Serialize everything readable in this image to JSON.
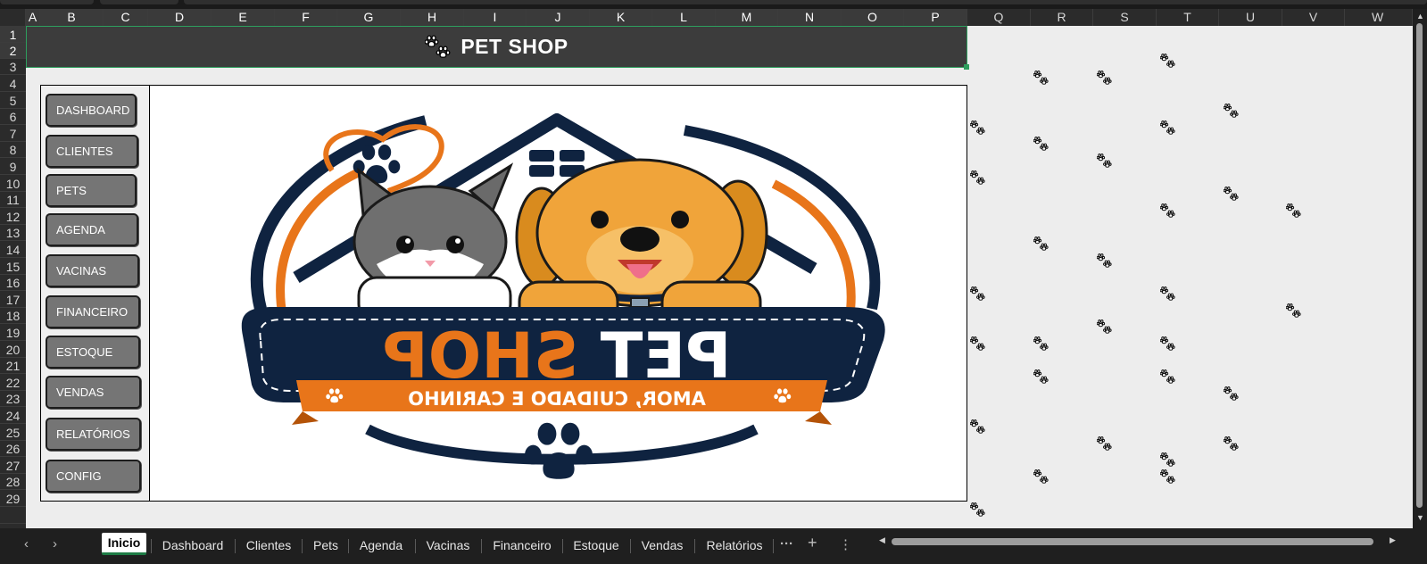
{
  "columns": [
    "A",
    "B",
    "C",
    "D",
    "E",
    "F",
    "G",
    "H",
    "I",
    "J",
    "K",
    "L",
    "M",
    "N",
    "O",
    "P",
    "Q",
    "R",
    "S",
    "T",
    "U",
    "V",
    "W"
  ],
  "rows": [
    "1",
    "2",
    "3",
    "4",
    "5",
    "6",
    "7",
    "8",
    "9",
    "10",
    "11",
    "12",
    "13",
    "14",
    "15",
    "16",
    "17",
    "18",
    "19",
    "20",
    "21",
    "22",
    "23",
    "24",
    "25",
    "26",
    "27",
    "28",
    "29"
  ],
  "banner": {
    "title": "PET SHOP",
    "icon": "paw-icon"
  },
  "nav": [
    {
      "label": "DASHBOARD"
    },
    {
      "label": "CLIENTES"
    },
    {
      "label": "PETS"
    },
    {
      "label": "AGENDA"
    },
    {
      "label": "VACINAS"
    },
    {
      "label": "FINANCEIRO"
    },
    {
      "label": "ESTOQUE"
    },
    {
      "label": "VENDAS"
    },
    {
      "label": "RELATÓRIOS"
    },
    {
      "label": "CONFIG"
    }
  ],
  "logo": {
    "brand": "PET SHOP",
    "tagline": "AMOR, CUIDADO E CARINHO",
    "colors": {
      "navy": "#0f2340",
      "orange": "#e8751a",
      "gold": "#f0a43a"
    }
  },
  "tabs": [
    {
      "label": "Inicio",
      "active": true
    },
    {
      "label": "Dashboard"
    },
    {
      "label": "Clientes"
    },
    {
      "label": "Pets"
    },
    {
      "label": "Agenda"
    },
    {
      "label": "Vacinas"
    },
    {
      "label": "Financeiro"
    },
    {
      "label": "Estoque"
    },
    {
      "label": "Vendas"
    },
    {
      "label": "Relatórios"
    }
  ],
  "tabbar": {
    "more": "···",
    "add": "+",
    "options": "⋮",
    "prev": "‹",
    "next": "›"
  },
  "colors": {
    "banner": "#3c3c3c",
    "button": "#757575",
    "selection": "#2e9e5e",
    "sheet": "#ededed"
  }
}
